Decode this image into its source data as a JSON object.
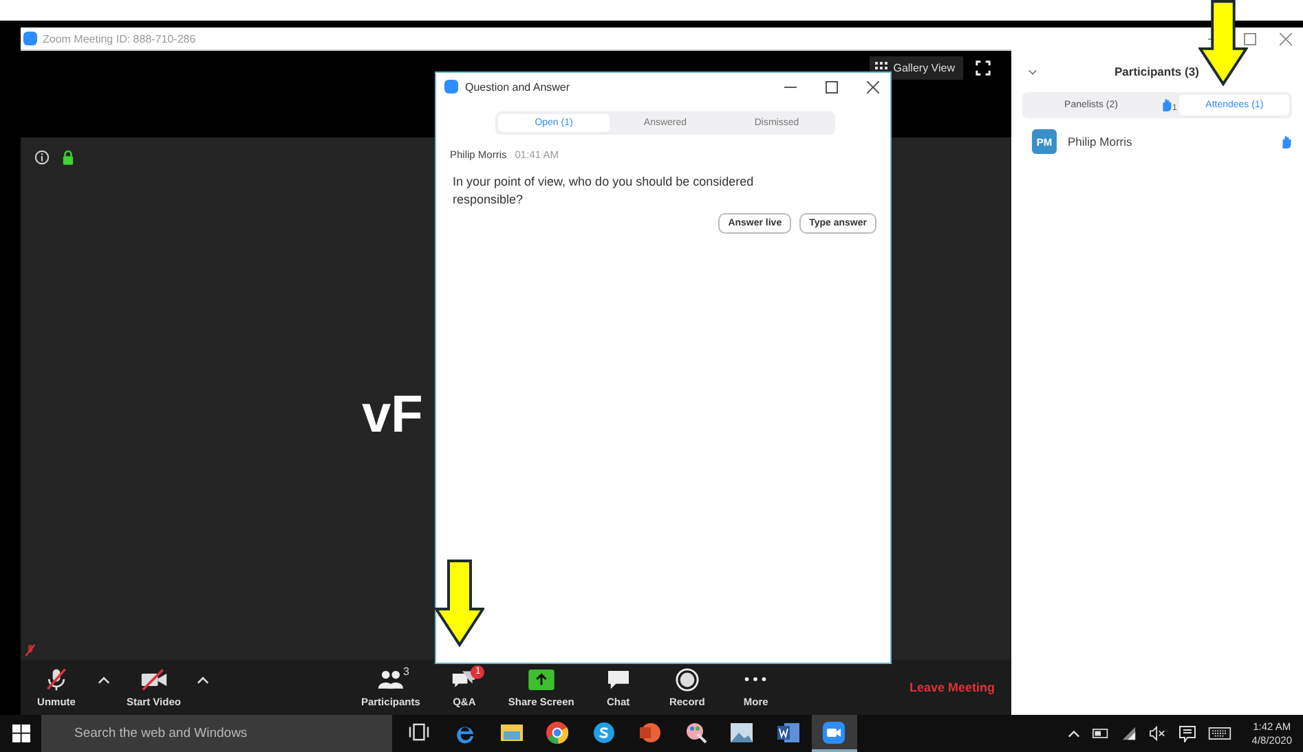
{
  "window": {
    "title": "Zoom Meeting ID: 888-710-286"
  },
  "view_controls": {
    "gallery_label": "Gallery View"
  },
  "video": {
    "name": "vF"
  },
  "toolbar": {
    "items": [
      {
        "kind": "mic-muted",
        "label": "Unmute",
        "caret": true
      },
      {
        "kind": "video-muted",
        "label": "Start Video",
        "caret": true
      },
      {
        "kind": "participants",
        "label": "Participants",
        "count": "3"
      },
      {
        "kind": "qa",
        "label": "Q&A",
        "badge": "1"
      },
      {
        "kind": "share",
        "label": "Share Screen"
      },
      {
        "kind": "chat",
        "label": "Chat"
      },
      {
        "kind": "record",
        "label": "Record"
      },
      {
        "kind": "more",
        "label": "More"
      }
    ],
    "leave": "Leave Meeting"
  },
  "qa_dialog": {
    "title": "Question and Answer",
    "tabs": [
      {
        "label": "Open (1)",
        "selected": true
      },
      {
        "label": "Answered",
        "selected": false
      },
      {
        "label": "Dismissed",
        "selected": false
      }
    ],
    "questions": [
      {
        "author": "Philip Morris",
        "time": "01:41 AM",
        "text": "In your point of view, who do you should be considered responsible?",
        "buttons": [
          "Answer live",
          "Type answer"
        ]
      }
    ]
  },
  "participants_panel": {
    "title": "Participants (3)",
    "tabs": [
      {
        "label": "Panelists (2)",
        "selected": false
      },
      {
        "label": "Attendees (1)",
        "selected": true,
        "hand_count": "1"
      }
    ],
    "attendees": [
      {
        "initials": "PM",
        "name": "Philip Morris",
        "hand_raised": true
      }
    ]
  },
  "taskbar": {
    "search_placeholder": "Search the web and Windows",
    "apps": [
      {
        "kind": "taskview",
        "selected": false
      },
      {
        "kind": "edge",
        "selected": false
      },
      {
        "kind": "explorer",
        "selected": false
      },
      {
        "kind": "chrome",
        "selected": false
      },
      {
        "kind": "skype",
        "selected": false
      },
      {
        "kind": "powerpoint",
        "selected": false
      },
      {
        "kind": "paint",
        "selected": false
      },
      {
        "kind": "photos",
        "selected": false
      },
      {
        "kind": "word",
        "selected": false
      },
      {
        "kind": "zoom",
        "selected": true
      }
    ],
    "time": "1:42 AM",
    "date": "4/8/2020"
  }
}
